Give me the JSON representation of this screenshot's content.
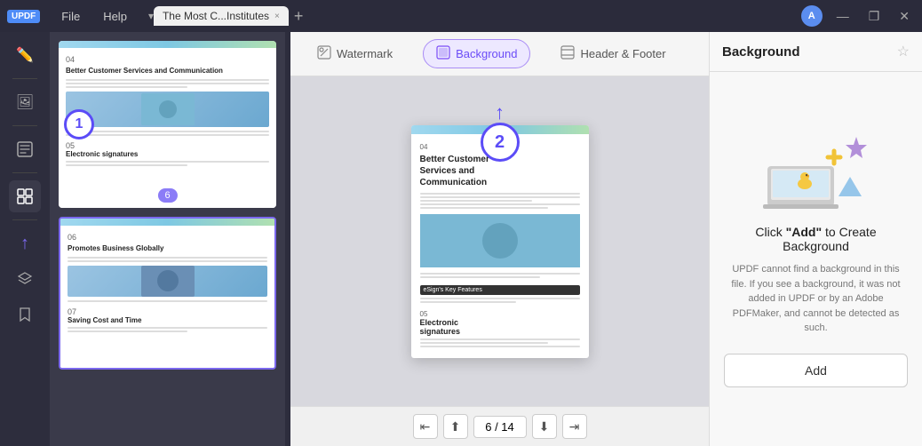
{
  "titlebar": {
    "logo": "UPDF",
    "menu_file": "File",
    "menu_help": "Help",
    "tab_label": "The Most C...Institutes",
    "tab_close": "×",
    "dropdown_char": "▾",
    "new_tab_char": "+",
    "avatar_letter": "A",
    "win_minimize": "—",
    "win_restore": "❐",
    "win_close": "✕"
  },
  "sidebar": {
    "icons": [
      {
        "name": "sidebar-icon-edit",
        "symbol": "✏",
        "active": false
      },
      {
        "name": "sidebar-icon-dash",
        "symbol": "—",
        "active": false
      },
      {
        "name": "sidebar-icon-stamp",
        "symbol": "🖼",
        "active": false
      },
      {
        "name": "sidebar-icon-dash2",
        "symbol": "—",
        "active": false
      },
      {
        "name": "sidebar-icon-text",
        "symbol": "📄",
        "active": false
      },
      {
        "name": "sidebar-icon-dash3",
        "symbol": "—",
        "active": false
      },
      {
        "name": "sidebar-icon-organize",
        "symbol": "⊞",
        "active": true
      },
      {
        "name": "sidebar-icon-dash4",
        "symbol": "—",
        "active": false
      },
      {
        "name": "sidebar-icon-arrow",
        "symbol": "↑",
        "active": false
      },
      {
        "name": "sidebar-icon-layers",
        "symbol": "❖",
        "active": false
      },
      {
        "name": "sidebar-icon-bookmark",
        "symbol": "🔖",
        "active": false
      }
    ]
  },
  "thumbnails": [
    {
      "id": "thumb-1",
      "page_num": "04",
      "heading": "Better Customer Services and Communication",
      "has_image": true,
      "sub_page_num": "05",
      "sub_heading": "Electronic signatures",
      "badge": "6",
      "active": false,
      "number_overlay": "1"
    },
    {
      "id": "thumb-2",
      "page_num": "06",
      "heading": "Promotes Business Globally",
      "has_image": true,
      "sub_page_num": "07",
      "sub_heading": "Saving Cost and Time",
      "badge": null,
      "active": true,
      "number_overlay": null
    }
  ],
  "toolbar": {
    "watermark_label": "Watermark",
    "background_label": "Background",
    "header_footer_label": "Header & Footer"
  },
  "page_view": {
    "page_num": "04",
    "heading": "Better Customer Services and Communication",
    "sub_page_num": "05",
    "sub_heading": "Electronic signatures",
    "tag_label": "eSign's Key Features"
  },
  "pagination": {
    "current": "6",
    "total": "14",
    "separator": "/",
    "first": "⇤",
    "prev_fast": "⇧",
    "prev": "‹",
    "next": "›",
    "next_fast": "⇩",
    "last": "⇥"
  },
  "right_panel": {
    "title": "Background",
    "star": "☆",
    "click_label_pre": "Click ",
    "click_label_bold": "\"Add\"",
    "click_label_post": " to Create Background",
    "desc": "UPDF cannot find a background in this file. If you see a background, it was not added in UPDF or by an Adobe PDFMaker, and cannot be detected as such.",
    "add_button": "Add"
  },
  "colors": {
    "accent_purple": "#6b4cf7",
    "accent_teal": "#7ec8e3",
    "accent_green": "#b0e0b0",
    "badge_purple": "#8b7cf7"
  }
}
